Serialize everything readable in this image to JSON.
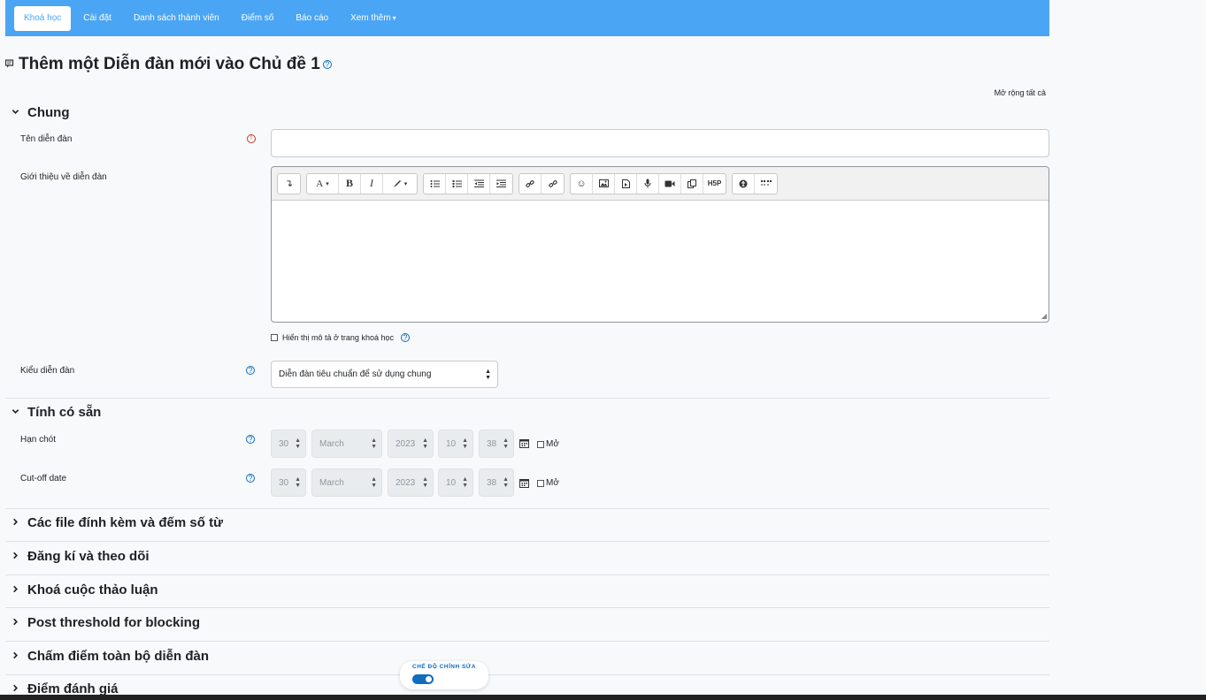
{
  "nav": {
    "tabs": [
      {
        "label": "Khoá học",
        "active": true
      },
      {
        "label": "Cài đặt"
      },
      {
        "label": "Danh sách thành viên"
      },
      {
        "label": "Điểm số"
      },
      {
        "label": "Báo cáo"
      },
      {
        "label": "Xem thêm",
        "dropdown": true
      }
    ],
    "dropdown_chevron": "▾"
  },
  "page": {
    "title": "Thêm một Diễn đàn mới vào Chủ đề 1",
    "forum_icon": "forum-icon",
    "help_glyph": "?",
    "expand_all": "Mở rộng tất cả"
  },
  "sections": {
    "general": {
      "title": "Chung",
      "expanded": true,
      "forum_name_label": "Tên diễn đàn",
      "forum_name_value": "",
      "intro_label": "Giới thiệu về diễn đàn",
      "show_description_label": "Hiển thị mô tả ở trang khoá học",
      "show_description_checked": false,
      "forum_type_label": "Kiểu diễn đàn",
      "forum_type_value": "Diễn đàn tiêu chuẩn để sử dụng chung"
    },
    "availability": {
      "title": "Tính có sẵn",
      "expanded": true,
      "due_date": {
        "label": "Hạn chót",
        "day": "30",
        "month": "March",
        "year": "2023",
        "hour": "10",
        "minute": "38",
        "enable_label": "Mở",
        "enabled": false
      },
      "cutoff_date": {
        "label": "Cut-off date",
        "day": "30",
        "month": "March",
        "year": "2023",
        "hour": "10",
        "minute": "38",
        "enable_label": "Mở",
        "enabled": false
      }
    },
    "collapsed": [
      "Các file đính kèm và đếm số từ",
      "Đăng kí và theo dõi",
      "Khoá cuộc thảo luận",
      "Post threshold for blocking",
      "Chấm điểm toàn bộ diễn đàn",
      "Điểm đánh giá"
    ]
  },
  "editor": {
    "toolbar_icons": [
      [
        "collapse-icon"
      ],
      [
        "font-color-icon",
        "bold-icon",
        "italic-icon",
        "highlight-icon"
      ],
      [
        "bullet-list-icon",
        "numbered-list-icon",
        "outdent-icon",
        "indent-icon"
      ],
      [
        "link-icon",
        "unlink-icon"
      ],
      [
        "emoji-icon",
        "image-icon",
        "media-icon",
        "record-audio-icon",
        "record-video-icon",
        "manage-files-icon",
        "h5p-icon"
      ],
      [
        "accessibility-checker-icon",
        "screenreader-helper-icon"
      ]
    ],
    "h5p_label": "H5P"
  },
  "edit_mode": {
    "label": "CHẾ ĐỘ CHỈNH SỬA",
    "on": true
  },
  "colors": {
    "nav_bg": "#4ba5f5",
    "primary": "#0f6cbf",
    "required": "#ca3120"
  }
}
